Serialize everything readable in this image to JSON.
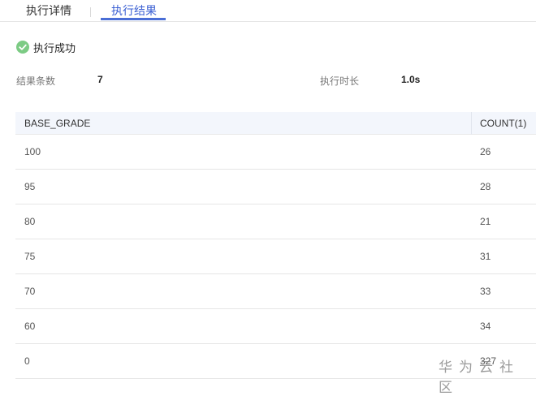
{
  "tabs": [
    {
      "label": "执行详情"
    },
    {
      "label": "执行结果"
    }
  ],
  "status": {
    "text": "执行成功",
    "color": "#7ccb84"
  },
  "meta": {
    "count_label": "结果条数",
    "count_value": "7",
    "duration_label": "执行时长",
    "duration_value": "1.0s"
  },
  "table": {
    "columns": [
      "BASE_GRADE",
      "COUNT(1)"
    ],
    "rows": [
      [
        "100",
        "26"
      ],
      [
        "95",
        "28"
      ],
      [
        "80",
        "21"
      ],
      [
        "75",
        "31"
      ],
      [
        "70",
        "33"
      ],
      [
        "60",
        "34"
      ],
      [
        "0",
        "327"
      ]
    ]
  },
  "watermark": "华为云社区",
  "colors": {
    "accent": "#4a6ed6",
    "header_bg": "#f3f6fc"
  }
}
